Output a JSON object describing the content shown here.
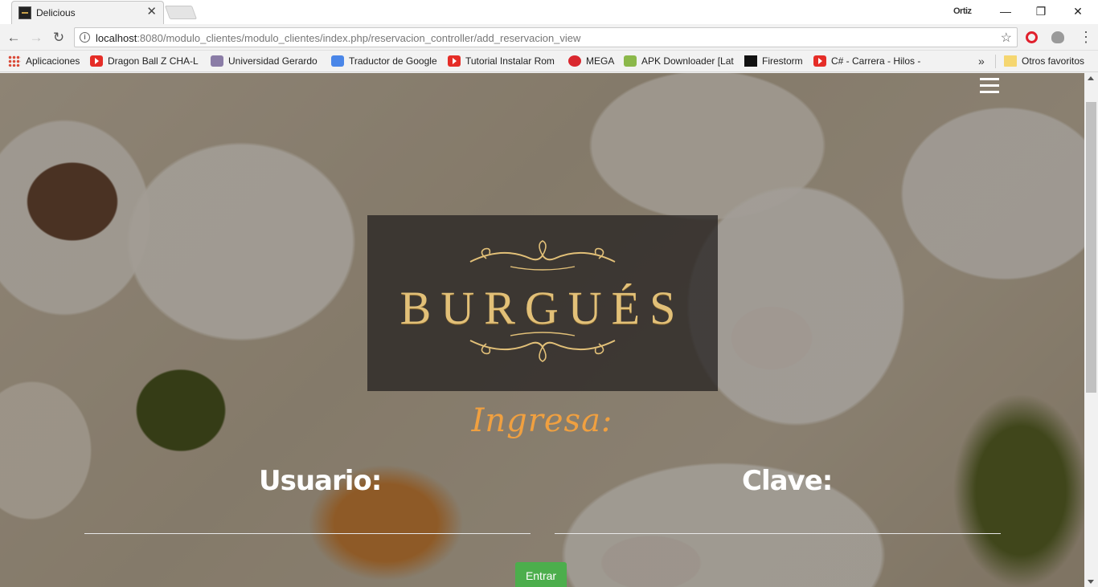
{
  "browser": {
    "tab": {
      "title": "Delicious",
      "close_glyph": "✕"
    },
    "profile_name": "Ortiz",
    "window_controls": {
      "minimize": "—",
      "maximize": "❐",
      "close": "✕"
    },
    "address_bar": {
      "host": "localhost",
      "rest": ":8080/modulo_clientes/modulo_clientes/index.php/reservacion_controller/add_reservacion_view"
    },
    "bookmarks": [
      {
        "label": "Aplicaciones",
        "icon": "apps-grid-icon"
      },
      {
        "label": "Dragon Ball Z CHA-L",
        "icon": "youtube-icon"
      },
      {
        "label": "Universidad Gerardo",
        "icon": "university-icon"
      },
      {
        "label": "Traductor de Google",
        "icon": "google-translate-icon"
      },
      {
        "label": "Tutorial Instalar Rom",
        "icon": "youtube-icon"
      },
      {
        "label": "MEGA",
        "icon": "mega-icon"
      },
      {
        "label": "APK Downloader [Lat",
        "icon": "apk-icon"
      },
      {
        "label": "Firestorm",
        "icon": "firestorm-icon"
      },
      {
        "label": "C# - Carrera - Hilos -",
        "icon": "youtube-icon"
      }
    ],
    "bookmarks_more": "»",
    "other_bookmarks": "Otros favoritos"
  },
  "page": {
    "logo": "BURGUÉS",
    "heading": "Ingresa:",
    "user_label": "Usuario:",
    "pass_label": "Clave:",
    "user_value": "",
    "pass_value": "",
    "submit_label": "Entrar",
    "colors": {
      "accent": "#f0a040",
      "gold": "#e2c078",
      "button": "#4cae4c"
    }
  }
}
